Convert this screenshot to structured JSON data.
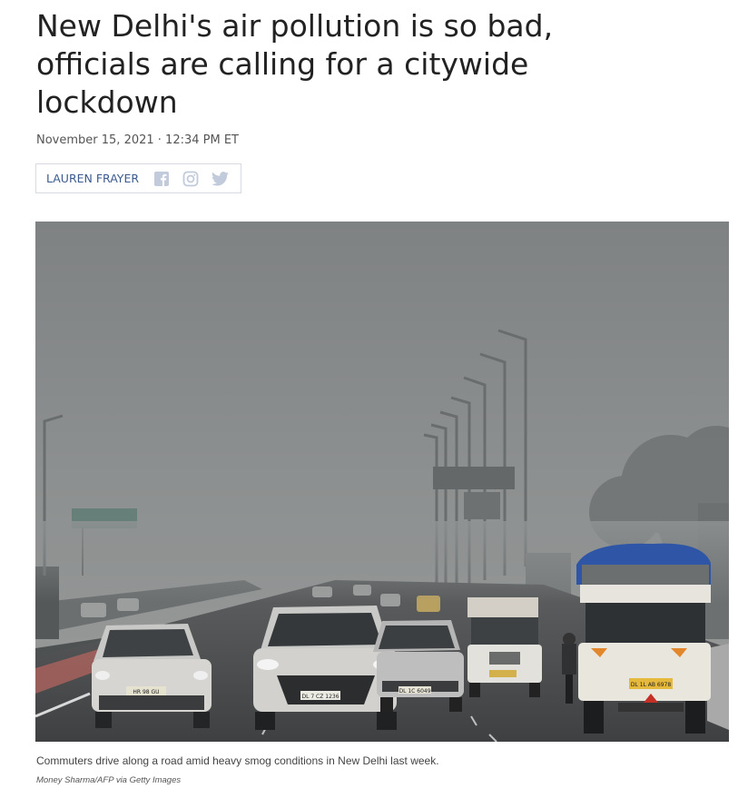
{
  "article": {
    "headline": "New Delhi's air pollution is so bad, officials are calling for a citywide lockdown",
    "dateline": "November 15, 2021 · 12:34 PM ET"
  },
  "byline": {
    "author": "LAUREN FRAYER",
    "icons": [
      "facebook-icon",
      "instagram-icon",
      "twitter-icon"
    ]
  },
  "photo": {
    "caption": "Commuters drive along a road amid heavy smog conditions in New Delhi last week.",
    "credit": "Money Sharma/AFP via Getty Images",
    "plates": [
      "HR 98 GU",
      "DL 7 CZ 1236",
      "DL 1C 6049",
      "DL 1L AB 6978"
    ]
  },
  "colors": {
    "headline": "#222222",
    "author_link": "#3b5a8f",
    "social_icon": "#c2cbdb",
    "smog": "#8a8d8e"
  }
}
